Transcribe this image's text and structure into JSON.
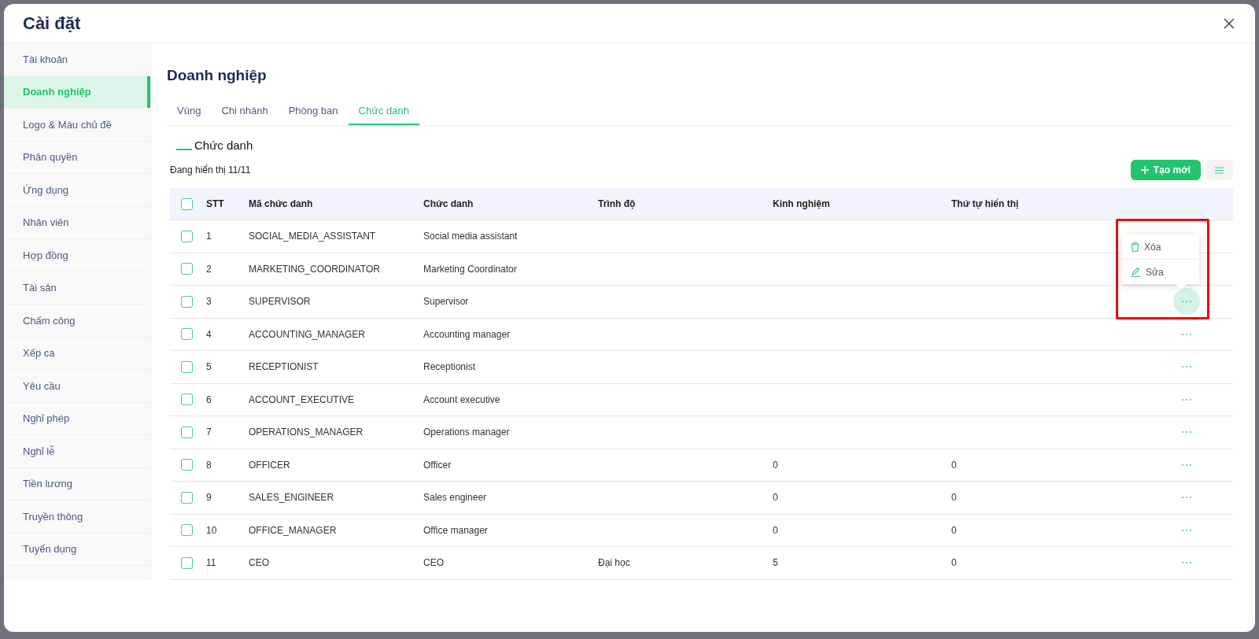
{
  "dialog": {
    "title": "Cài đặt"
  },
  "sidebar": {
    "items": [
      {
        "label": "Tài khoản",
        "selected": false
      },
      {
        "label": "Doanh nghiệp",
        "selected": true
      },
      {
        "label": "Logo & Màu chủ đề",
        "selected": false
      },
      {
        "label": "Phân quyền",
        "selected": false
      },
      {
        "label": "Ứng dụng",
        "selected": false
      },
      {
        "label": "Nhân viên",
        "selected": false
      },
      {
        "label": "Hợp đồng",
        "selected": false
      },
      {
        "label": "Tài sản",
        "selected": false
      },
      {
        "label": "Chấm công",
        "selected": false
      },
      {
        "label": "Xếp ca",
        "selected": false
      },
      {
        "label": "Yêu cầu",
        "selected": false
      },
      {
        "label": "Nghỉ phép",
        "selected": false
      },
      {
        "label": "Nghỉ lễ",
        "selected": false
      },
      {
        "label": "Tiền lương",
        "selected": false
      },
      {
        "label": "Truyền thông",
        "selected": false
      },
      {
        "label": "Tuyển dụng",
        "selected": false
      }
    ]
  },
  "page_title": "Doanh nghiệp",
  "tabs": [
    {
      "label": "Vùng",
      "selected": false
    },
    {
      "label": "Chi nhánh",
      "selected": false
    },
    {
      "label": "Phòng ban",
      "selected": false
    },
    {
      "label": "Chức danh",
      "selected": true
    }
  ],
  "section_title": "Chức danh",
  "count_text": "Đang hiển thị 11/11",
  "create_button": "Tạo mới",
  "table": {
    "all_checked": false,
    "columns": [
      "STT",
      "Mã chức danh",
      "Chức danh",
      "Trình độ",
      "Kinh nghiệm",
      "Thứ tự hiển thị"
    ],
    "rows": [
      {
        "checked": false,
        "menu_open": false,
        "no": "1",
        "code": "SOCIAL_MEDIA_ASSISTANT",
        "title": "Social media assistant"
      },
      {
        "checked": false,
        "menu_open": false,
        "no": "2",
        "code": "MARKETING_COORDINATOR",
        "title": "Marketing Coordinator"
      },
      {
        "checked": false,
        "menu_open": true,
        "no": "3",
        "code": "SUPERVISOR",
        "title": "Supervisor"
      },
      {
        "checked": false,
        "menu_open": false,
        "no": "4",
        "code": "ACCOUNTING_MANAGER",
        "title": "Accounting manager"
      },
      {
        "checked": false,
        "menu_open": false,
        "no": "5",
        "code": "RECEPTIONIST",
        "title": "Receptionist"
      },
      {
        "checked": false,
        "menu_open": false,
        "no": "6",
        "code": "ACCOUNT_EXECUTIVE",
        "title": "Account executive"
      },
      {
        "checked": false,
        "menu_open": false,
        "no": "7",
        "code": "OPERATIONS_MANAGER",
        "title": "Operations manager"
      },
      {
        "checked": false,
        "menu_open": false,
        "no": "8",
        "code": "OFFICER",
        "title": "Officer",
        "experience": "0",
        "display_order": "0"
      },
      {
        "checked": false,
        "menu_open": false,
        "no": "9",
        "code": "SALES_ENGINEER",
        "title": "Sales engineer",
        "experience": "0",
        "display_order": "0"
      },
      {
        "checked": false,
        "menu_open": false,
        "no": "10",
        "code": "OFFICE_MANAGER",
        "title": "Office manager",
        "experience": "0",
        "display_order": "0"
      },
      {
        "checked": false,
        "menu_open": false,
        "no": "11",
        "code": "CEO",
        "title": "CEO",
        "education": "Đại học",
        "experience": "5",
        "display_order": "0"
      }
    ]
  },
  "action_menu": [
    {
      "kind": "delete",
      "label": "Xóa"
    },
    {
      "kind": "edit",
      "label": "Sửa"
    }
  ]
}
